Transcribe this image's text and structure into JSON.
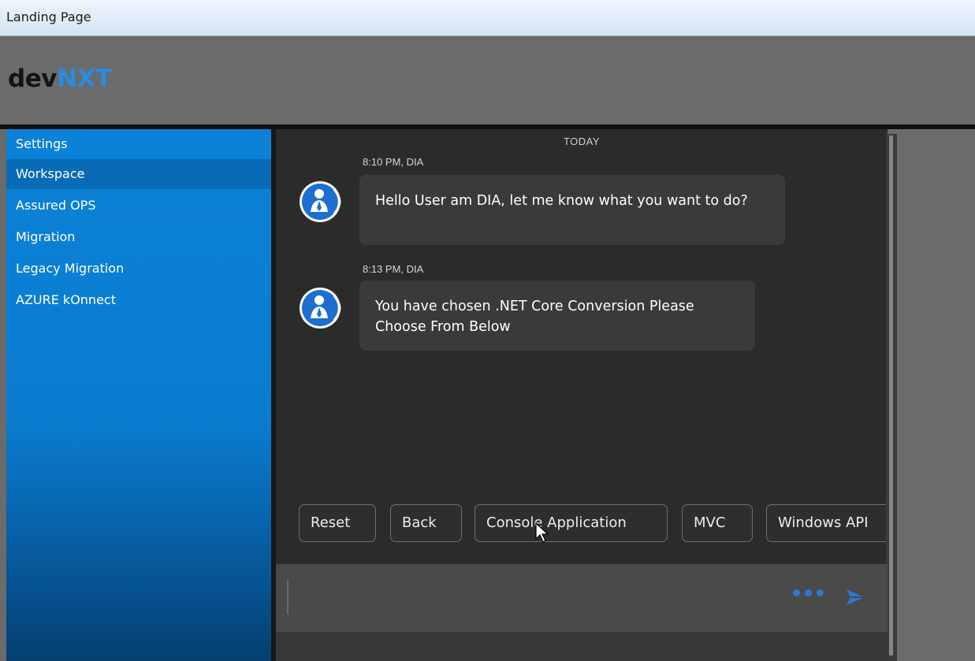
{
  "window": {
    "title": "Landing Page"
  },
  "logo": {
    "part1": "dev",
    "part2": "NXT"
  },
  "sidebar": {
    "items": [
      {
        "label": "Settings"
      },
      {
        "label": "Workspace"
      },
      {
        "label": "Assured OPS"
      },
      {
        "label": "Migration"
      },
      {
        "label": "Legacy Migration"
      },
      {
        "label": "AZURE kOnnect"
      }
    ]
  },
  "chat": {
    "day_label": "TODAY",
    "messages": [
      {
        "meta": "8:10 PM, DIA",
        "text": "Hello User am DIA, let me know what you want to do?"
      },
      {
        "meta": "8:13 PM, DIA",
        "text": "You have chosen .NET Core Conversion Please Choose From Below"
      }
    ],
    "quick_replies": [
      {
        "label": "Reset"
      },
      {
        "label": "Back"
      },
      {
        "label": "Console Application"
      },
      {
        "label": "MVC"
      },
      {
        "label": "Windows API"
      }
    ]
  },
  "input": {
    "value": "",
    "placeholder": ""
  },
  "colors": {
    "sidebar": "#0b82d8",
    "chat_bg": "#2b2b2b",
    "bubble": "#3a3a3a",
    "accent": "#2b78d6",
    "logo_accent": "#2a8be2"
  },
  "icons": {
    "avatar": "bot-avatar-icon",
    "dots": "more-dots-icon",
    "send": "send-icon"
  }
}
